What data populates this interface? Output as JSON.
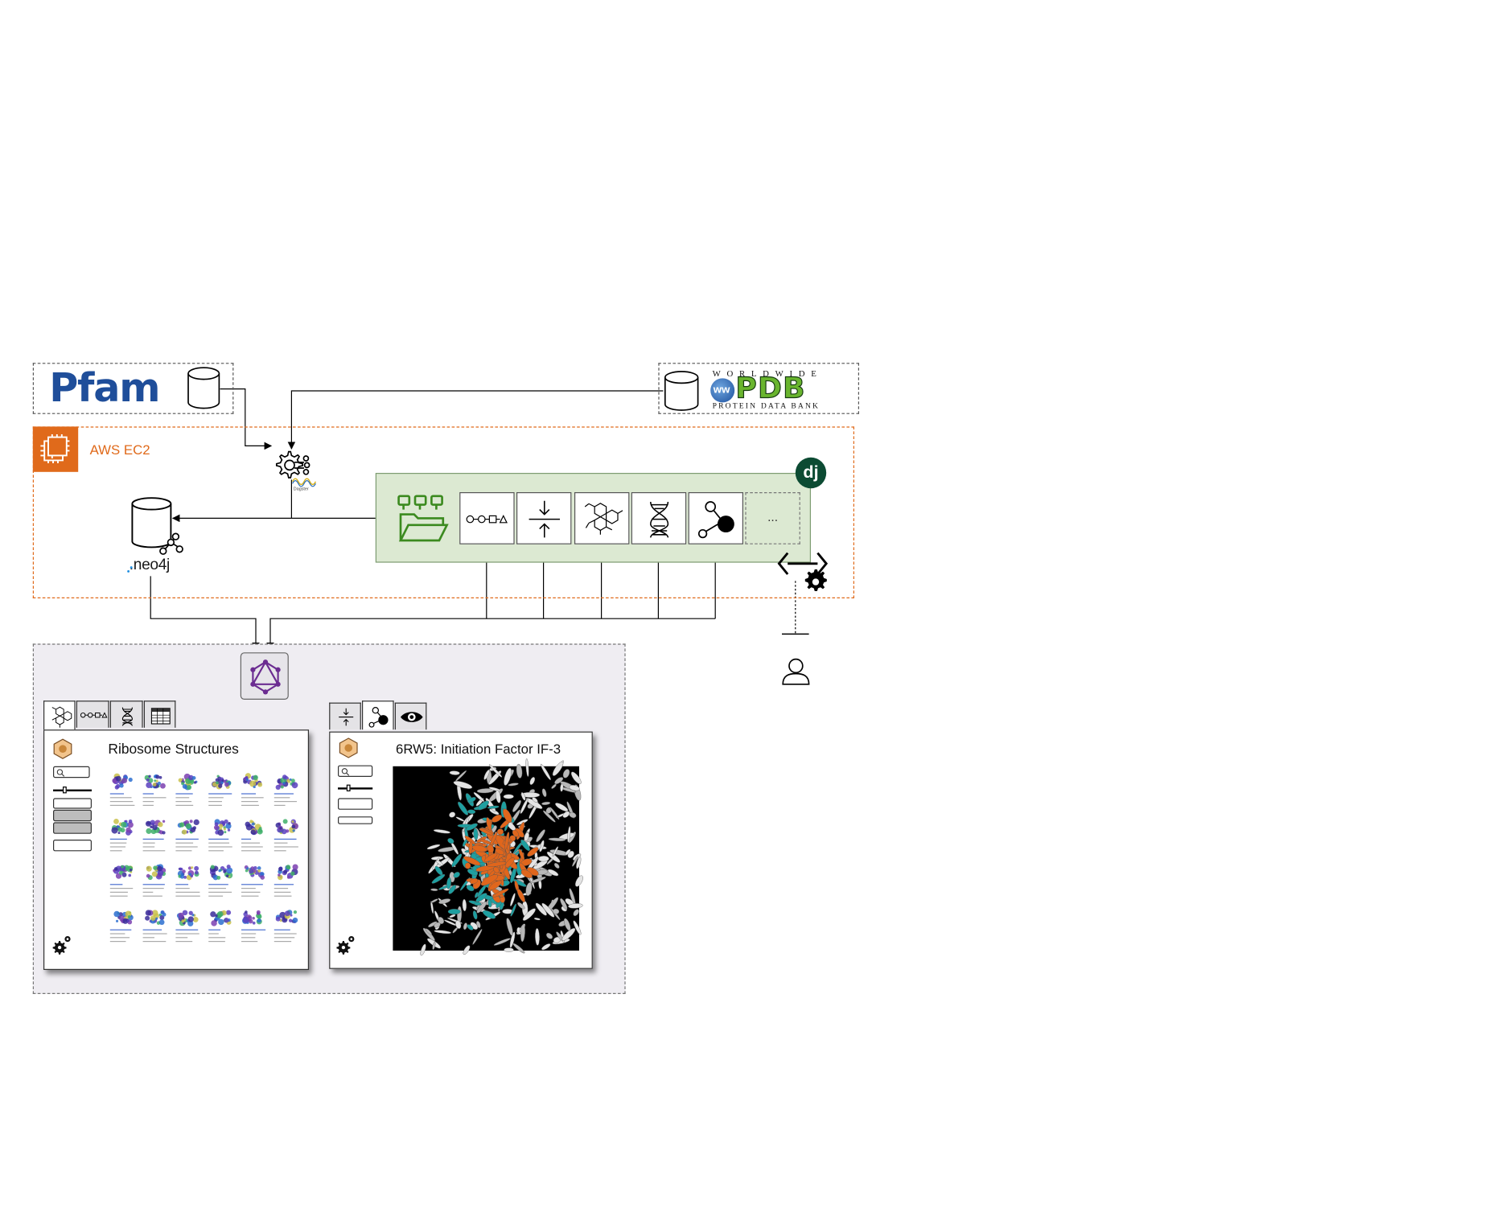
{
  "sources": {
    "pfam": {
      "logo_text": "Pfam"
    },
    "pdb": {
      "top_text": "WORLDWIDE",
      "logo_text": "PDB",
      "ww_text": "ww",
      "bottom_text": "PROTEIN DATA BANK"
    }
  },
  "aws": {
    "label": "AWS EC2"
  },
  "etl": {
    "logo_text": "Dagster"
  },
  "neo4j": {
    "label": ".neo4j"
  },
  "django": {
    "badge": "dj",
    "more_label": "..."
  },
  "colors": {
    "aws_orange": "#E06A1B",
    "django_green": "#0C4B33",
    "app_panel_bg": "#EFEDF2",
    "backend_bg": "#DCE9D2",
    "folder_green": "#3B8A1F",
    "graphql_purple": "#6B2C91",
    "molecule_orange": "#E0661C",
    "molecule_teal": "#1E9FA0"
  },
  "frontend": {
    "left_window": {
      "title": "Ribosome Structures"
    },
    "right_window": {
      "title": "6RW5: Initiation Factor IF-3"
    }
  },
  "icons": [
    "pfam-database-icon",
    "pdb-database-icon",
    "aws-ec2-icon",
    "etl-gear-icon",
    "neo4j-database-icon",
    "folder-icon",
    "sequence-icon",
    "compress-icon",
    "molecule-icon",
    "dna-icon",
    "graph-node-icon",
    "api-gear-icon",
    "user-icon",
    "graphql-icon",
    "eye-icon",
    "search-icon",
    "settings-gear-icon"
  ]
}
